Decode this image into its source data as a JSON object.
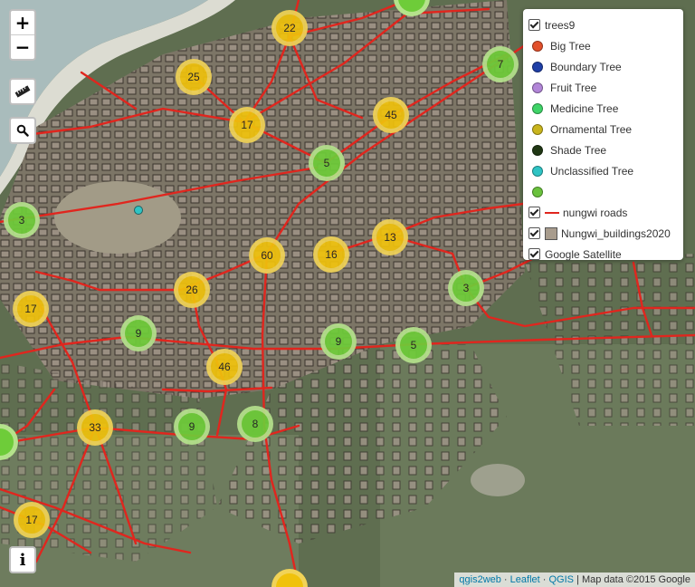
{
  "map": {
    "type": "satellite-map",
    "road_color": "#e0261e"
  },
  "controls": {
    "zoom_in": "+",
    "zoom_out": "−",
    "info": "i"
  },
  "clusters": [
    {
      "label": "22",
      "color": "yellow"
    },
    {
      "label": "25",
      "color": "yellow"
    },
    {
      "label": "17",
      "color": "yellow"
    },
    {
      "label": "45",
      "color": "yellow"
    },
    {
      "label": "7",
      "color": "green"
    },
    {
      "label": "5",
      "color": "green"
    },
    {
      "label": "3",
      "color": "green"
    },
    {
      "label": "60",
      "color": "yellow"
    },
    {
      "label": "16",
      "color": "yellow"
    },
    {
      "label": "13",
      "color": "yellow"
    },
    {
      "label": "26",
      "color": "yellow"
    },
    {
      "label": "17",
      "color": "yellow"
    },
    {
      "label": "3",
      "color": "green"
    },
    {
      "label": "9",
      "color": "green"
    },
    {
      "label": "9",
      "color": "green"
    },
    {
      "label": "5",
      "color": "green"
    },
    {
      "label": "46",
      "color": "yellow"
    },
    {
      "label": "33",
      "color": "yellow"
    },
    {
      "label": "9",
      "color": "green"
    },
    {
      "label": "8",
      "color": "green"
    },
    {
      "label": "17",
      "color": "yellow"
    }
  ],
  "cluster_colors": {
    "yellow": {
      "outer": "#f1d357",
      "inner": "#f0c20c"
    },
    "green": {
      "outer": "#b5e28c",
      "inner": "#6ecc39"
    }
  },
  "legend": {
    "layer_trees": "trees9",
    "entries": [
      {
        "label": "Big Tree",
        "color": "#e2502b"
      },
      {
        "label": "Boundary Tree",
        "color": "#1f3fa8"
      },
      {
        "label": "Fruit Tree",
        "color": "#b286d8"
      },
      {
        "label": "Medicine Tree",
        "color": "#3fd468"
      },
      {
        "label": "Ornamental Tree",
        "color": "#c9b51d"
      },
      {
        "label": "Shade Tree",
        "color": "#203714"
      },
      {
        "label": "Unclassified Tree",
        "color": "#2fc4c4"
      },
      {
        "label": "",
        "color": "#6ac23d"
      }
    ],
    "layer_roads": "nungwi roads",
    "layer_buildings": "Nungwi_buildings2020",
    "layer_satellite": "Google Satellite"
  },
  "attribution": {
    "qgis2web": "qgis2web",
    "leaflet": "Leaflet",
    "qgis": "QGIS",
    "mapdata": "Map data ©2015 Google",
    "sep1": " · ",
    "sep2": " · ",
    "sep3": " | "
  }
}
